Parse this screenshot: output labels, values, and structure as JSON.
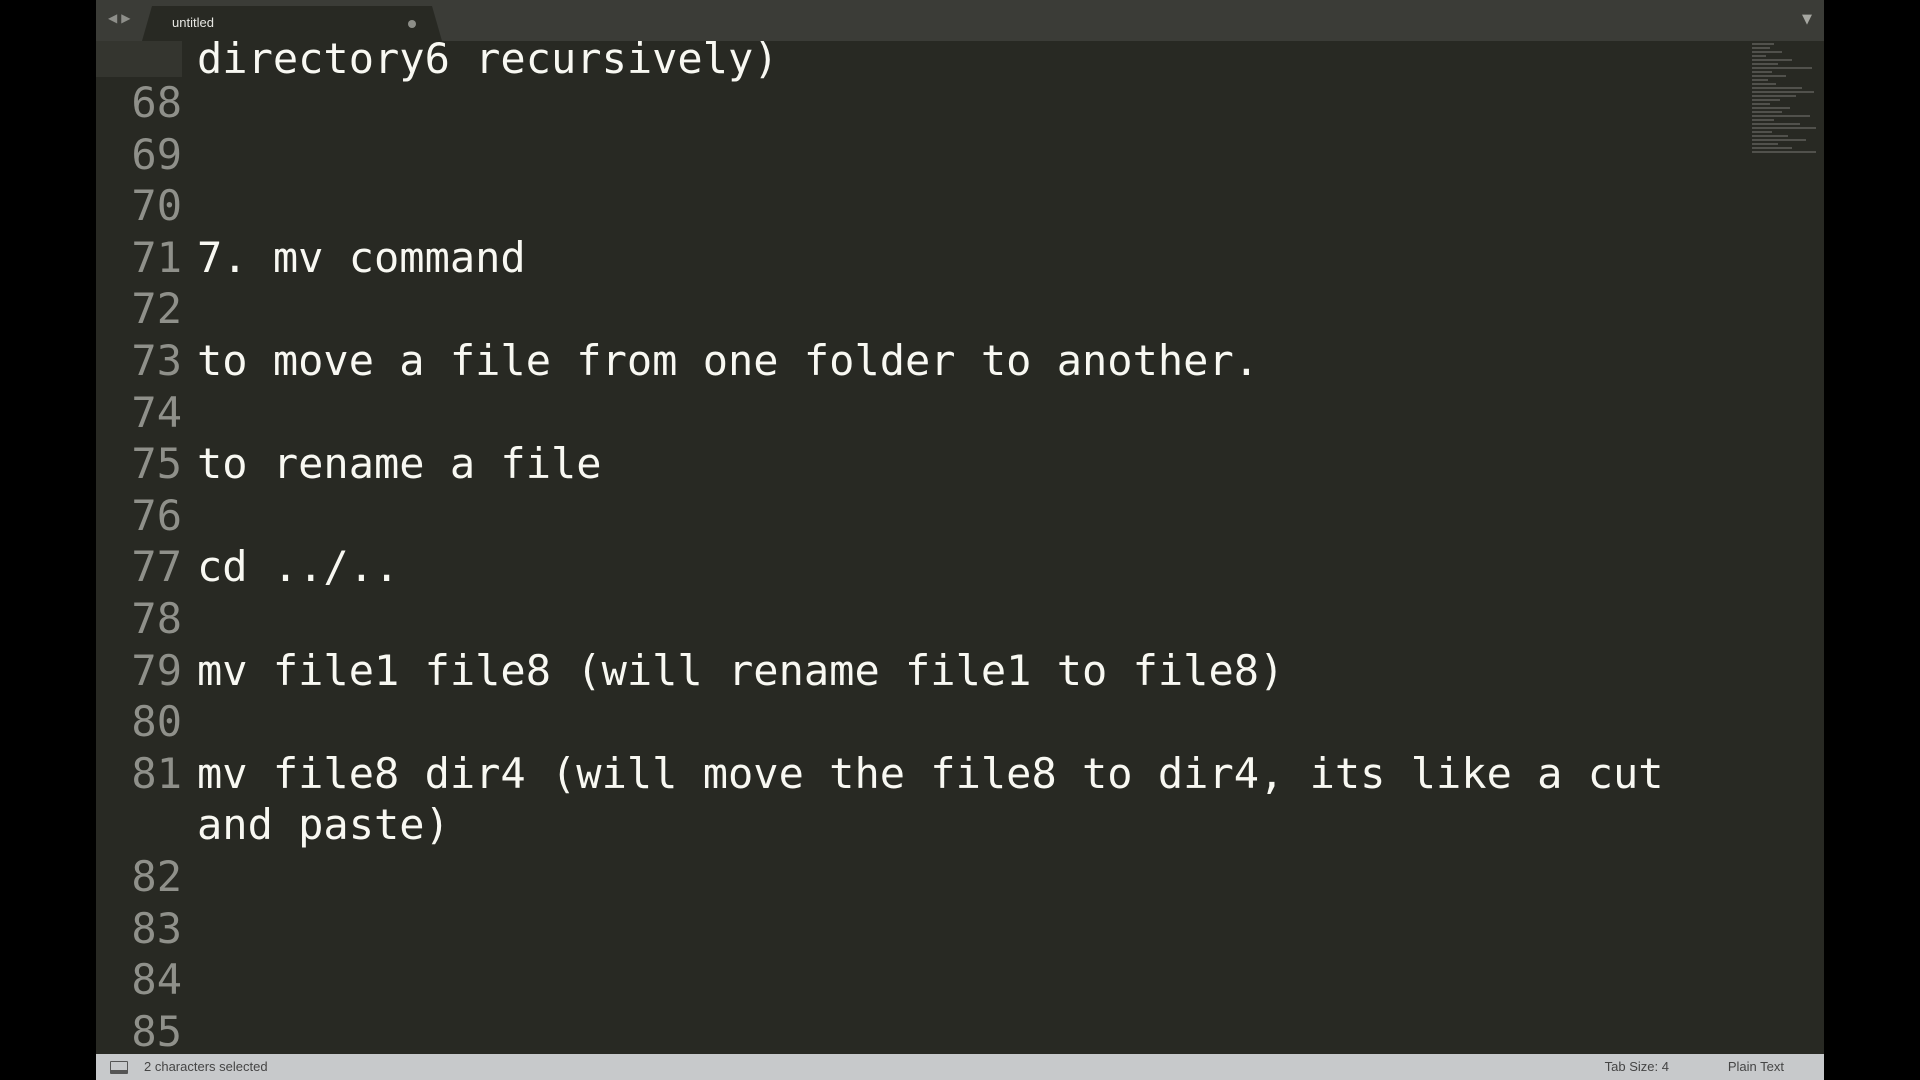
{
  "tab": {
    "title": "untitled"
  },
  "nav": {
    "back": "◀",
    "forward": "▶"
  },
  "tab_menu_icon": "▼",
  "editor": {
    "lines": [
      {
        "num": "",
        "text": "directory6 recursively)"
      },
      {
        "num": "68",
        "text": ""
      },
      {
        "num": "69",
        "text": ""
      },
      {
        "num": "70",
        "text": ""
      },
      {
        "num": "71",
        "text": "7. mv command"
      },
      {
        "num": "72",
        "text": ""
      },
      {
        "num": "73",
        "text": "to move a file from one folder to another."
      },
      {
        "num": "74",
        "text": ""
      },
      {
        "num": "75",
        "text": "to rename a file"
      },
      {
        "num": "76",
        "text": ""
      },
      {
        "num": "77",
        "text": "cd ../.."
      },
      {
        "num": "78",
        "text": ""
      },
      {
        "num": "79",
        "text": "mv file1 file8 (will rename file1 to file8)"
      },
      {
        "num": "80",
        "text": ""
      },
      {
        "num": "81",
        "text": "mv file8 dir4 (will move the file8 to dir4, its like a cut and paste)"
      },
      {
        "num": "82",
        "text": ""
      },
      {
        "num": "83",
        "text": ""
      },
      {
        "num": "84",
        "text": ""
      },
      {
        "num": "85",
        "text": ""
      }
    ]
  },
  "status": {
    "selection": "2 characters selected",
    "tab_size": "Tab Size: 4",
    "syntax": "Plain Text"
  }
}
